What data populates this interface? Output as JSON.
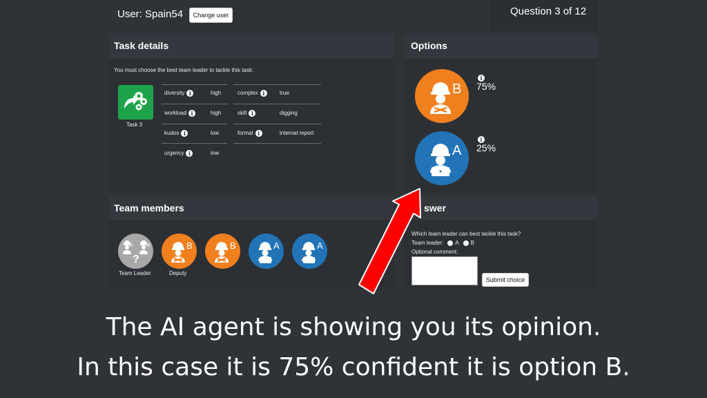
{
  "header": {
    "user_label": "User: Spain54",
    "change_user_button": "Change user",
    "question_counter": "Question 3 of 12"
  },
  "task_details": {
    "title": "Task details",
    "instruction": "You must choose the best team leader to tackle this task:",
    "task_label": "Task 3",
    "attributes_left": [
      {
        "name": "diversity",
        "value": "high"
      },
      {
        "name": "workload",
        "value": "high"
      },
      {
        "name": "kudos",
        "value": "low"
      },
      {
        "name": "urgency",
        "value": "low"
      }
    ],
    "attributes_right": [
      {
        "name": "complex",
        "value": "true"
      },
      {
        "name": "skill",
        "value": "digging"
      },
      {
        "name": "format",
        "value": "internal report"
      }
    ]
  },
  "options": {
    "title": "Options",
    "items": [
      {
        "letter": "B",
        "confidence": "75%",
        "color": "#f07f1e"
      },
      {
        "letter": "A",
        "confidence": "25%",
        "color": "#2274b7"
      }
    ]
  },
  "team_members": {
    "title": "Team members",
    "members": [
      {
        "label": "Team Leader",
        "color": "#a8a8a8",
        "letter_a": "A",
        "letter_b": "B",
        "mark": "?"
      },
      {
        "label": "Deputy",
        "color": "#f07f1e",
        "letter": "B"
      },
      {
        "label": "",
        "color": "#f07f1e",
        "letter": "B"
      },
      {
        "label": "",
        "color": "#2274b7",
        "letter": "A"
      },
      {
        "label": "",
        "color": "#2274b7",
        "letter": "A"
      }
    ]
  },
  "answer": {
    "title_partial": "swer",
    "question": "Which team leader can best tackle this task?",
    "team_leader_label": "Team leader:",
    "option_a": "A",
    "option_b": "B",
    "comment_label": "Optional comment:",
    "submit_button": "Submit choice"
  },
  "caption": {
    "line1": "The AI agent is showing you its opinion.",
    "line2": "In this case it is 75% confident it is option B."
  },
  "colors": {
    "background": "#2f3337",
    "arrow": "#ff0000",
    "task_icon": "#1fa34a",
    "orange": "#f07f1e",
    "blue": "#2274b7"
  }
}
